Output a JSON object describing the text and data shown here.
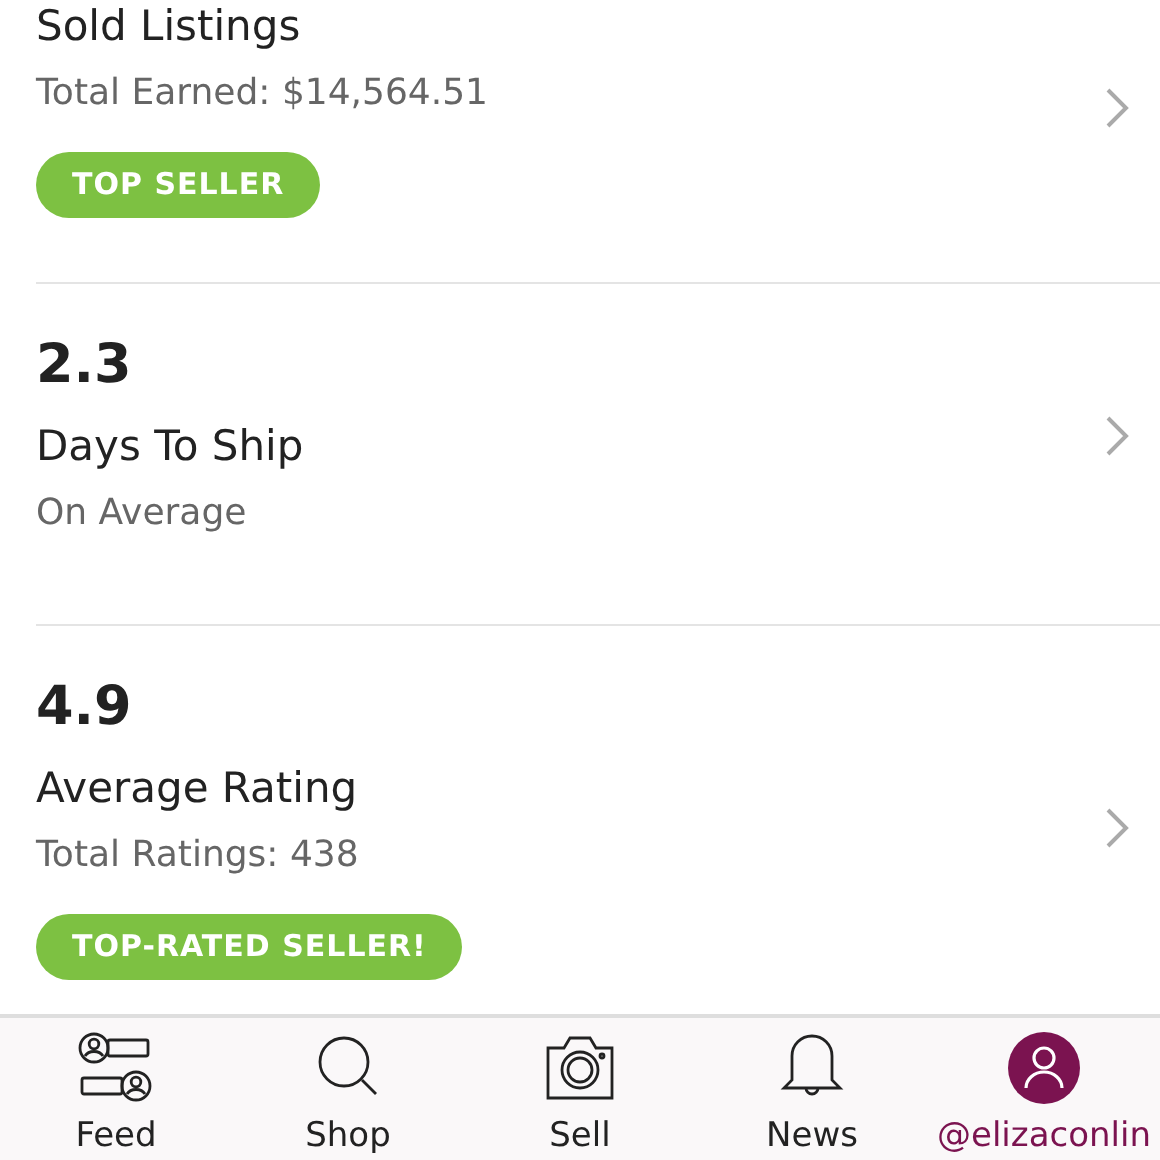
{
  "stats": [
    {
      "title": "Sold Listings",
      "subtitle": "Total Earned: $14,564.51",
      "badge": "TOP SELLER"
    },
    {
      "value": "2.3",
      "title": "Days To Ship",
      "subtitle": "On Average"
    },
    {
      "value": "4.9",
      "title": "Average Rating",
      "subtitle": "Total Ratings: 438",
      "badge": "TOP-RATED SELLER!"
    }
  ],
  "tab_bar": [
    {
      "kind": "feed",
      "label": "Feed",
      "selected": false
    },
    {
      "kind": "shop",
      "label": "Shop",
      "selected": false
    },
    {
      "kind": "sell",
      "label": "Sell",
      "selected": false
    },
    {
      "kind": "news",
      "label": "News",
      "selected": false
    },
    {
      "kind": "profile",
      "label": "@elizaconlin",
      "selected": true
    }
  ]
}
